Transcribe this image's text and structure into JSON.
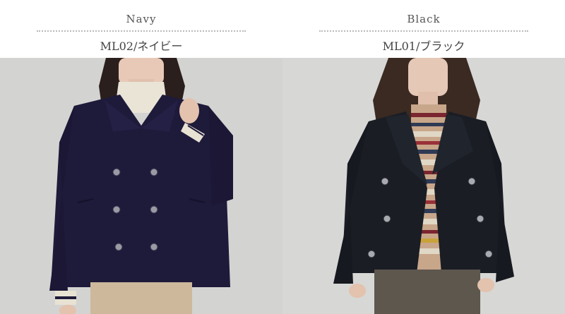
{
  "products": [
    {
      "color_name": "Navy",
      "code_label": "ML02/ネイビー",
      "coat_color": "#1e1a3a"
    },
    {
      "color_name": "Black",
      "code_label": "ML01/ブラック",
      "coat_color": "#1a1d24"
    }
  ]
}
